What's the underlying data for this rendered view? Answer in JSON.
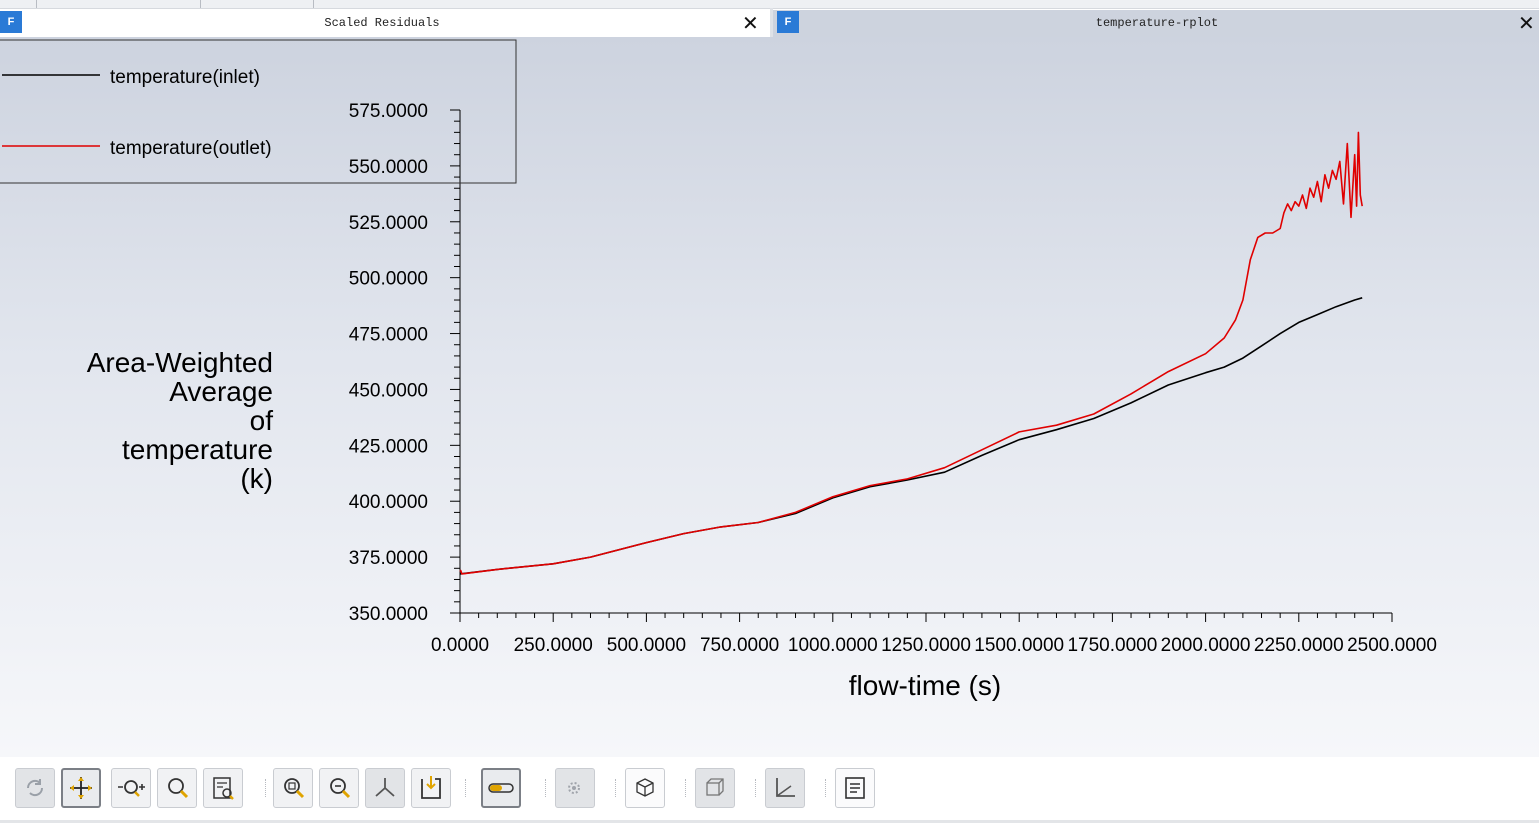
{
  "left_tab": {
    "title": "Scaled Residuals",
    "logo": "F",
    "close": "✕"
  },
  "right_tab": {
    "title": "temperature-rplot",
    "logo": "F",
    "close": "✕"
  },
  "legend": [
    {
      "label": "temperature(inlet)",
      "color": "#000000"
    },
    {
      "label": "temperature(outlet)",
      "color": "#e00000"
    }
  ],
  "chart_data": {
    "type": "line",
    "xlabel": "flow-time (s)",
    "ylabel": "Area-Weighted Average of temperature (k)",
    "ylabel_lines": [
      "Area-Weighted",
      "Average",
      "of",
      "temperature",
      "(k)"
    ],
    "xlim": [
      0,
      2500
    ],
    "ylim": [
      350,
      575
    ],
    "x_ticks": [
      "0.0000",
      "250.0000",
      "500.0000",
      "750.0000",
      "1000.0000",
      "1250.0000",
      "1500.0000",
      "1750.0000",
      "2000.0000",
      "2250.0000",
      "2500.0000"
    ],
    "y_ticks": [
      "350.0000",
      "375.0000",
      "400.0000",
      "425.0000",
      "450.0000",
      "475.0000",
      "500.0000",
      "525.0000",
      "550.0000",
      "575.0000"
    ],
    "series": [
      {
        "name": "temperature(inlet)",
        "color": "#000000",
        "x": [
          0,
          100,
          250,
          350,
          500,
          600,
          700,
          800,
          900,
          1000,
          1100,
          1200,
          1300,
          1400,
          1500,
          1600,
          1700,
          1800,
          1900,
          2000,
          2050,
          2100,
          2150,
          2200,
          2250,
          2300,
          2350,
          2400,
          2420
        ],
        "y": [
          367.5,
          369.5,
          372,
          375,
          381.5,
          385.5,
          388.5,
          390.5,
          394.5,
          401.5,
          406.5,
          409.5,
          413,
          420.5,
          427.5,
          432,
          437,
          444,
          452,
          457.5,
          460,
          464,
          469.5,
          475,
          480,
          483.5,
          487,
          490,
          491
        ]
      },
      {
        "name": "temperature(outlet)",
        "color": "#e00000",
        "x": [
          0,
          2,
          5,
          100,
          250,
          350,
          500,
          600,
          700,
          800,
          900,
          1000,
          1100,
          1200,
          1300,
          1400,
          1500,
          1600,
          1700,
          1800,
          1900,
          2000,
          2050,
          2080,
          2100,
          2120,
          2140,
          2160,
          2180,
          2200,
          2210,
          2220,
          2230,
          2240,
          2250,
          2260,
          2270,
          2280,
          2290,
          2300,
          2310,
          2320,
          2330,
          2340,
          2350,
          2360,
          2370,
          2380,
          2390,
          2400,
          2405,
          2410,
          2415,
          2420
        ],
        "y": [
          368.5,
          369,
          367.5,
          369.5,
          372,
          375,
          381.5,
          385.5,
          388.5,
          390.5,
          395,
          402,
          407,
          410,
          415,
          423,
          431,
          434,
          439,
          448,
          458,
          466,
          473,
          481,
          490,
          508,
          518,
          520,
          520,
          522,
          529,
          533,
          530,
          534,
          532,
          537,
          531,
          540,
          536,
          543,
          534,
          546,
          540,
          548,
          544,
          552,
          533,
          560,
          527,
          555,
          532,
          565,
          537,
          532
        ]
      }
    ]
  },
  "toolbar": [
    {
      "name": "rotate-button",
      "icon": "rotate-icon",
      "state": "dim"
    },
    {
      "name": "pan-button",
      "icon": "pan-icon",
      "state": "active"
    },
    {
      "name": "zoom-button",
      "icon": "zoom-plus-minus-icon",
      "state": "normal"
    },
    {
      "name": "zoom-to-area-button",
      "icon": "magnifier-icon",
      "state": "normal"
    },
    {
      "name": "probe-button",
      "icon": "probe-icon",
      "state": "normal"
    },
    {
      "name": "fit-to-window-button",
      "icon": "zoom-fit-icon",
      "state": "normal"
    },
    {
      "name": "zoom-out-button",
      "icon": "zoom-out-icon",
      "state": "normal"
    },
    {
      "name": "axes-button",
      "icon": "axes-icon",
      "state": "dim"
    },
    {
      "name": "save-picture-button",
      "icon": "save-picture-icon",
      "state": "normal"
    },
    {
      "name": "colormap-button",
      "icon": "colormap-icon",
      "state": "active"
    },
    {
      "name": "view-options-button",
      "icon": "camera-gear-icon",
      "state": "dim"
    },
    {
      "name": "isometric-view-button",
      "icon": "cube-icon",
      "state": "white"
    },
    {
      "name": "outline-view-button",
      "icon": "cube-outline-icon",
      "state": "dim"
    },
    {
      "name": "plot-axes-button",
      "icon": "xy-axes-icon",
      "state": "dim"
    },
    {
      "name": "notes-button",
      "icon": "notes-icon",
      "state": "white"
    }
  ]
}
